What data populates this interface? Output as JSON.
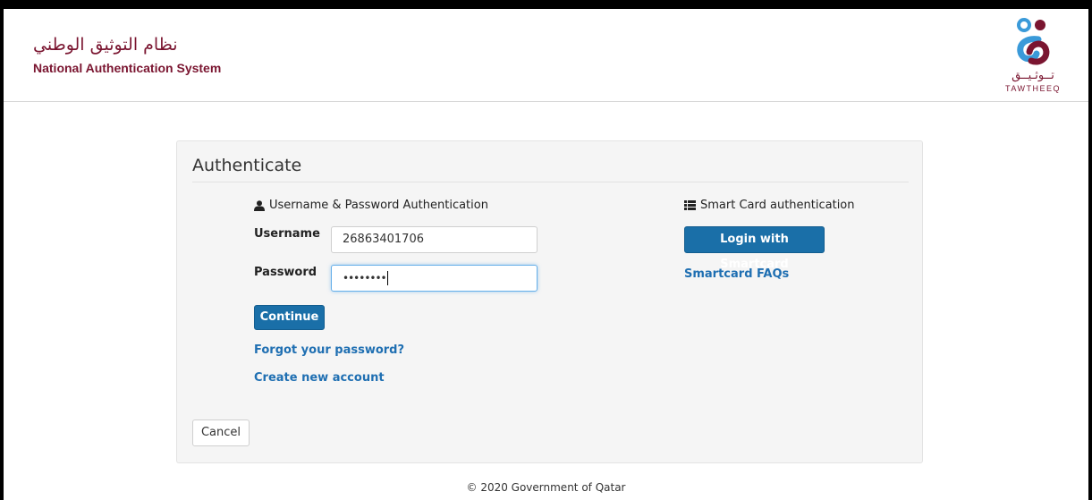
{
  "header": {
    "system_name_ar": "نظام التوثيق الوطني",
    "system_name_en": "National Authentication System",
    "logo_ar": "تــوثـيــق",
    "logo_en": "TAWTHEEQ"
  },
  "panel": {
    "title": "Authenticate",
    "userpass": {
      "heading": "Username & Password Authentication",
      "icon": "user-icon",
      "username_label": "Username",
      "username_value": "26863401706",
      "password_label": "Password",
      "password_masked": "••••••••",
      "continue_label": "Continue",
      "forgot_link": "Forgot your password?",
      "create_link": "Create new account"
    },
    "smartcard": {
      "heading": "Smart Card authentication",
      "icon": "list-icon",
      "login_button": "Login with Smartcard",
      "faq_link": "Smartcard FAQs"
    },
    "cancel_label": "Cancel"
  },
  "footer": {
    "copyright": "© 2020 Government of Qatar"
  },
  "colors": {
    "brand": "#7a1530",
    "accent_blue": "#1a6fa8",
    "logo_blue": "#3a9ad9",
    "link": "#1f6fb2"
  }
}
